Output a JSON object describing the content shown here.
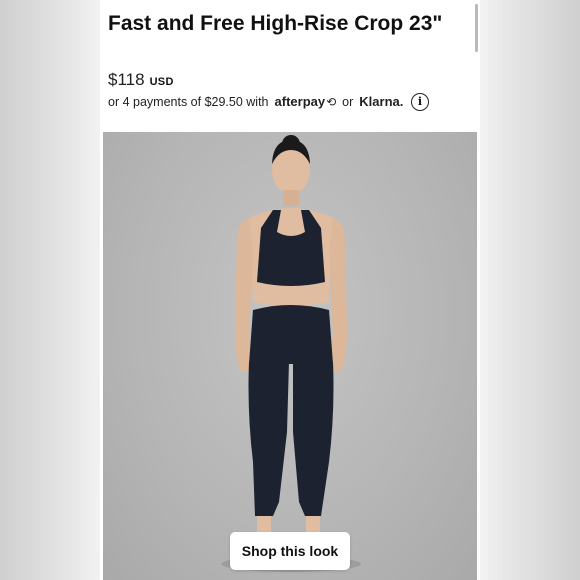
{
  "product": {
    "title": "Fast and Free High-Rise Crop 23\"",
    "price": "$118",
    "currency": "USD"
  },
  "payments": {
    "installments_text": "or 4 payments of $29.50 with",
    "afterpay_label": "afterpay",
    "afterpay_icon": "⟲",
    "or_text": "or",
    "klarna_label": "Klarna.",
    "info_icon": "i"
  },
  "hero": {
    "shop_button_label": "Shop this look"
  },
  "colors": {
    "outfit": "#1c2230",
    "background": "#b8b8b8",
    "skin": "#e0bca0"
  }
}
